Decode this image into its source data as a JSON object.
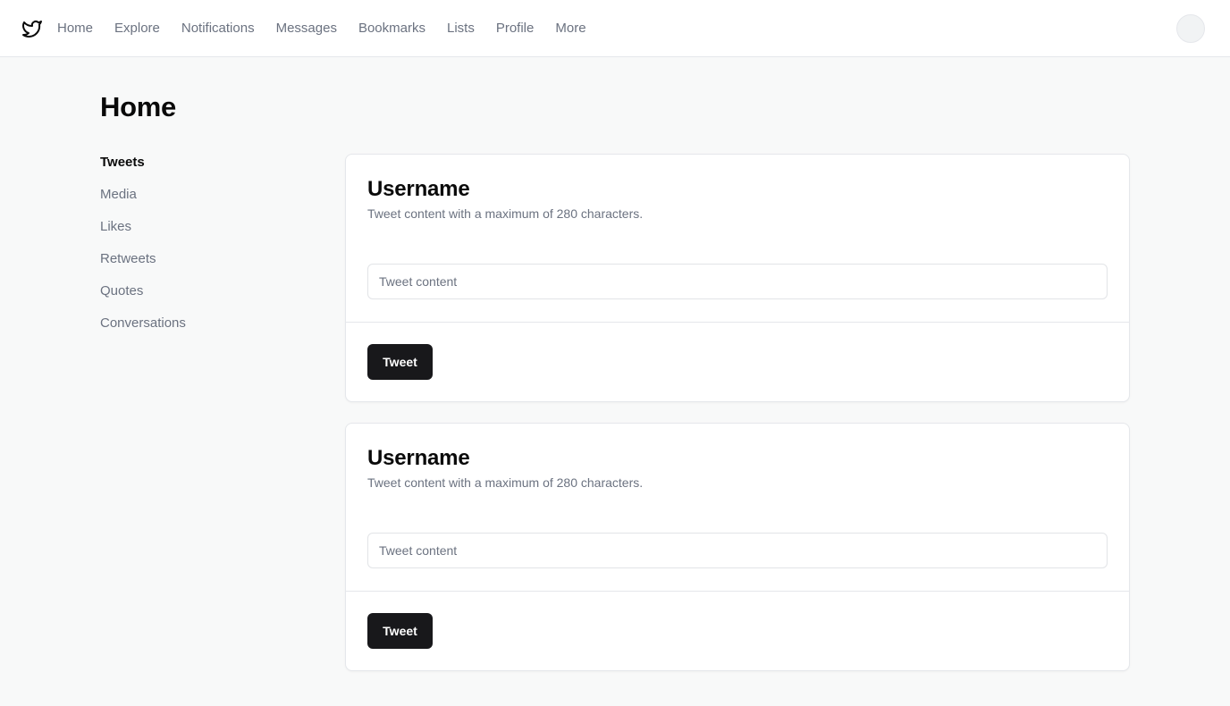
{
  "nav": {
    "items": [
      {
        "label": "Home"
      },
      {
        "label": "Explore"
      },
      {
        "label": "Notifications"
      },
      {
        "label": "Messages"
      },
      {
        "label": "Bookmarks"
      },
      {
        "label": "Lists"
      },
      {
        "label": "Profile"
      },
      {
        "label": "More"
      }
    ]
  },
  "page": {
    "title": "Home"
  },
  "sidebar": {
    "items": [
      {
        "label": "Tweets",
        "active": true
      },
      {
        "label": "Media"
      },
      {
        "label": "Likes"
      },
      {
        "label": "Retweets"
      },
      {
        "label": "Quotes"
      },
      {
        "label": "Conversations"
      }
    ]
  },
  "cards": [
    {
      "title": "Username",
      "description": "Tweet content with a maximum of 280 characters.",
      "input_placeholder": "Tweet content",
      "button_label": "Tweet"
    },
    {
      "title": "Username",
      "description": "Tweet content with a maximum of 280 characters.",
      "input_placeholder": "Tweet content",
      "button_label": "Tweet"
    }
  ],
  "icons": {
    "logo": "bird-icon"
  },
  "colors": {
    "button": "#18181b",
    "muted_text": "#6b7280",
    "background": "#f8f9f9"
  }
}
